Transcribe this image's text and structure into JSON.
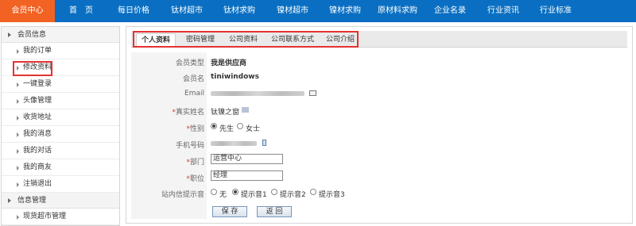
{
  "topnav": {
    "active_label": "会员中心",
    "items": [
      "首　页",
      "每日价格",
      "钛材超市",
      "钛材求购",
      "镍材超市",
      "镍材求购",
      "原材料求购",
      "企业名录",
      "行业资讯",
      "行业标准"
    ]
  },
  "sidebar": {
    "group1": "会员信息",
    "items": [
      "我的订单",
      "修改资料",
      "一键登录",
      "头像管理",
      "收货地址",
      "我的消息",
      "我的对话",
      "我的商友",
      "注销退出"
    ],
    "group2": "信息管理",
    "items2": [
      "现货超市管理"
    ]
  },
  "tabs": [
    "个人资料",
    "密码管理",
    "公司资料",
    "公司联系方式",
    "公司介绍"
  ],
  "form": {
    "member_type_label": "会员类型",
    "member_type_value": "我是供应商",
    "member_name_label": "会员名",
    "member_name_value": "tiniwindows",
    "email_label": "Email",
    "realname_label": "真实姓名",
    "realname_value": "钛镍之窗",
    "gender_label": "性别",
    "gender_options": [
      "先生",
      "女士"
    ],
    "phone_label": "手机号码",
    "dept_label": "部门",
    "dept_value": "运营中心",
    "position_label": "职位",
    "position_value": "经理",
    "notice_label": "站内信提示音",
    "notice_options": [
      "无",
      "提示音1",
      "提示音2",
      "提示音3"
    ],
    "required_mark": "*"
  },
  "buttons": {
    "save": "保 存",
    "back": "返 回"
  },
  "colors": {
    "nav": "#0a6fc2",
    "active": "#f26222",
    "highlight": "#e53232"
  }
}
